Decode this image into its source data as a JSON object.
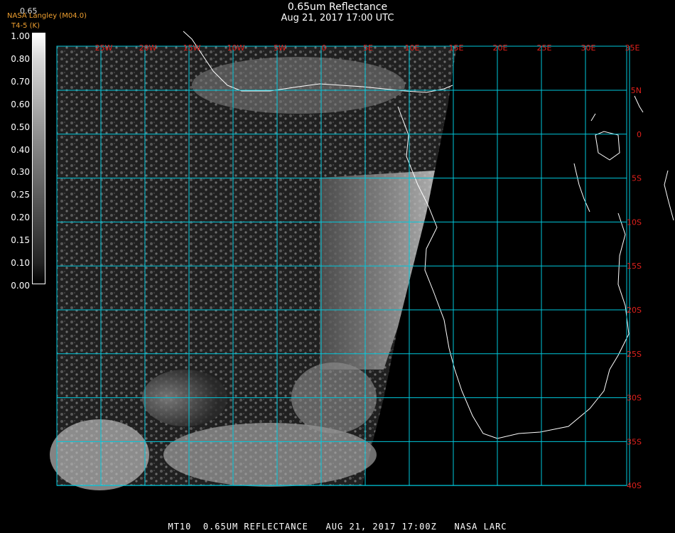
{
  "title": "0.65um Reflectance",
  "subtitle": "Aug 21, 2017 17:00 UTC",
  "credit": {
    "top_value": "0.65",
    "line1": "NASA Langley (M04.0)",
    "line2": "T4-5 (K)"
  },
  "scale_labels": [
    "1.00",
    "0.80",
    "0.70",
    "0.60",
    "0.50",
    "0.40",
    "0.30",
    "0.25",
    "0.20",
    "0.15",
    "0.10",
    "0.00"
  ],
  "lon_labels": [
    "25W",
    "20W",
    "15W",
    "10W",
    "5W",
    "0",
    "5E",
    "10E",
    "15E",
    "20E",
    "25E",
    "30E",
    "35E"
  ],
  "lat_labels": [
    "5N",
    "0",
    "5S",
    "10S",
    "15S",
    "20S",
    "25S",
    "30S",
    "35S",
    "40S"
  ],
  "colors": {
    "grid": "#00c8dc",
    "label": "#e0201c",
    "credit": "#f0a030",
    "coast": "#ffffff"
  },
  "bottom_text": "MT10  0.65UM REFLECTANCE   AUG 21, 2017 17:00Z   NASA LARC"
}
